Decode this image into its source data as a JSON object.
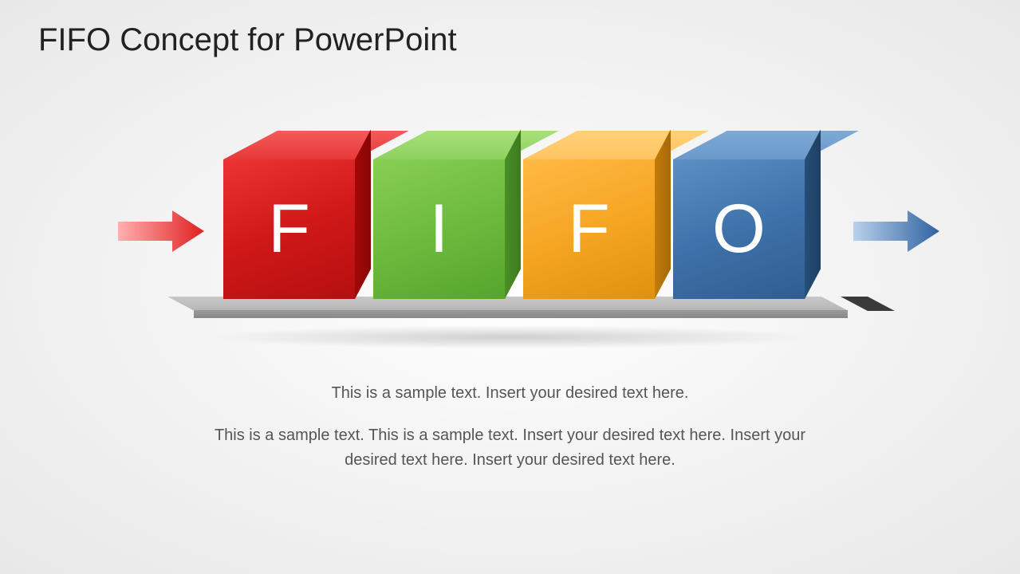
{
  "title": "FIFO Concept for PowerPoint",
  "cubes": [
    {
      "letter": "F",
      "color_name": "red",
      "front": "#d01818",
      "top": "#e63a3a",
      "side": "#a00808"
    },
    {
      "letter": "I",
      "color_name": "green",
      "front": "#6dbb3e",
      "top": "#8fd15f",
      "side": "#4a8f26"
    },
    {
      "letter": "F",
      "color_name": "orange",
      "front": "#f5a623",
      "top": "#ffc460",
      "side": "#c27c0a"
    },
    {
      "letter": "O",
      "color_name": "blue",
      "front": "#3e72aa",
      "top": "#6a99ca",
      "side": "#264e78"
    }
  ],
  "arrows": {
    "in_color": "#e63434",
    "out_color": "#4a7fc0"
  },
  "body": {
    "line1": "This is a sample text. Insert your desired text here.",
    "line2": "This is a sample text. This is a sample text. Insert your desired text here. Insert your desired text here. Insert your desired text here."
  }
}
